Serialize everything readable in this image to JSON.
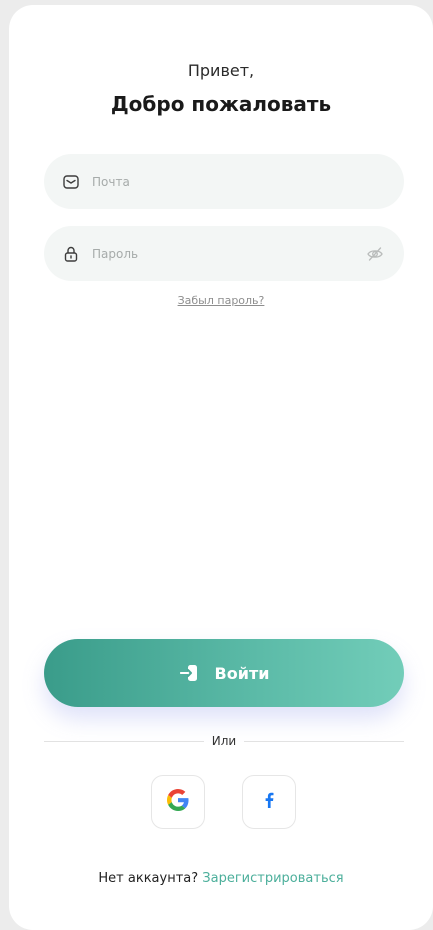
{
  "header": {
    "greeting": "Привет,",
    "title": "Добро пожаловать"
  },
  "form": {
    "email": {
      "placeholder": "Почта",
      "value": "",
      "icon": "mail-icon"
    },
    "password": {
      "placeholder": "Пароль",
      "value": "",
      "icon": "lock-icon",
      "toggle_icon": "eye-off-icon"
    },
    "forgot_label": "Забыл пароль?"
  },
  "actions": {
    "login_label": "Войти",
    "login_icon": "login-icon",
    "divider_label": "Или"
  },
  "social": [
    {
      "name": "google",
      "icon": "google-icon"
    },
    {
      "name": "facebook",
      "icon": "facebook-icon"
    }
  ],
  "footer": {
    "prompt": "Нет аккаунта?",
    "signup_label": "Зарегистрироваться"
  },
  "colors": {
    "accent": "#4caf9b",
    "button_start": "#3a9c8a",
    "button_end": "#72cdb9",
    "field_bg": "#f3f6f5"
  }
}
